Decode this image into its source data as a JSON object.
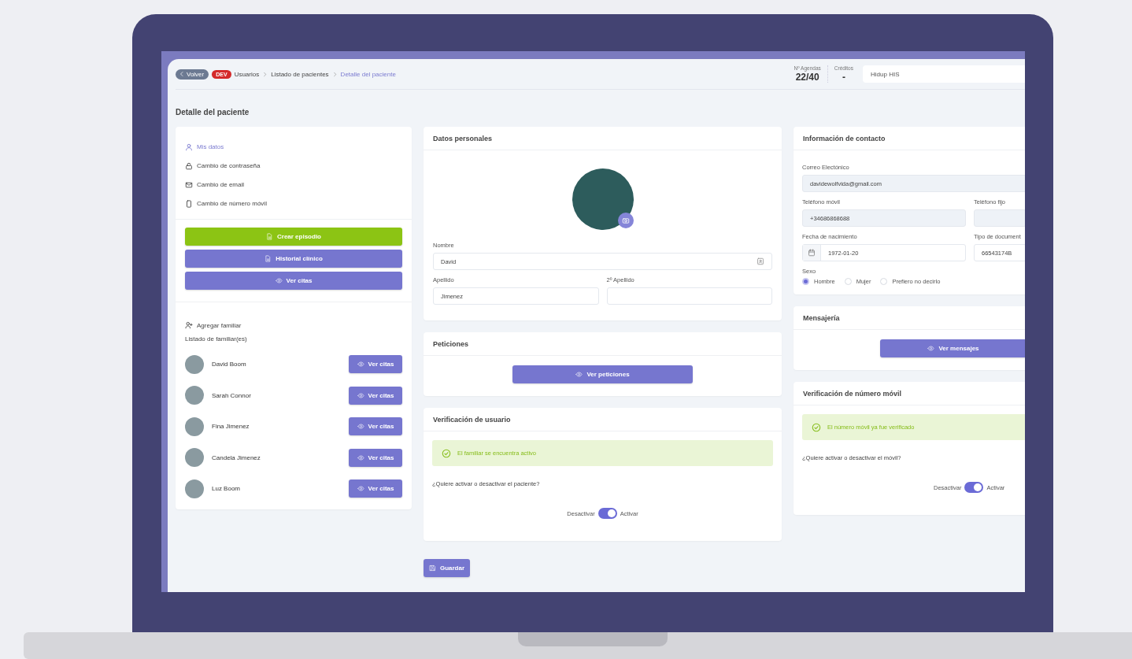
{
  "header": {
    "back_button": "Volver",
    "env_badge": "DEV",
    "breadcrumbs": [
      {
        "label": "Usuarios",
        "current": false
      },
      {
        "label": "Listado de pacientes",
        "current": false
      },
      {
        "label": "Detalle del paciente",
        "current": true
      }
    ],
    "stats": [
      {
        "label": "Nº Agendas",
        "value": "22/40"
      },
      {
        "label": "Créditos",
        "value": "-"
      }
    ],
    "center_select": "Hidup HIS"
  },
  "page_title": "Detalle del paciente",
  "profile_menu": [
    {
      "label": "Mis datos",
      "selected": true
    },
    {
      "label": "Cambio de contraseña",
      "selected": false
    },
    {
      "label": "Cambio de email",
      "selected": false
    },
    {
      "label": "Cambio de número móvil",
      "selected": false
    }
  ],
  "actions": [
    {
      "label": "Crear episodio",
      "kind": "success"
    },
    {
      "label": "Historial clínico",
      "kind": "primary"
    },
    {
      "label": "Ver citas",
      "kind": "primary"
    }
  ],
  "family": {
    "add_label": "Agregar familiar",
    "list_title": "Listado de familiar(es)",
    "members": [
      {
        "name": "David Boom",
        "button": "Ver citas"
      },
      {
        "name": "Sarah Connor",
        "button": "Ver citas"
      },
      {
        "name": "Fina Jimenez",
        "button": "Ver citas"
      },
      {
        "name": "Candela Jimenez",
        "button": "Ver citas"
      },
      {
        "name": "Luz Boom",
        "button": "Ver citas"
      }
    ]
  },
  "personal": {
    "title": "Datos personales",
    "fields": [
      {
        "label": "Nombre",
        "value": "David",
        "kind": "icon"
      },
      {
        "label": "Apellido",
        "value": "Jimenez",
        "kind": "text"
      },
      {
        "label": "2º Apellido",
        "kind": "text"
      }
    ]
  },
  "contact": {
    "title": "Información de contacto",
    "fields": [
      {
        "label": "Correo Electónico",
        "value": "davidewolfvida@gmail.com",
        "kind": "text",
        "disabled": true
      },
      {
        "label": "Teléfono móvil",
        "value": "+34686868688",
        "kind": "text",
        "disabled": true
      },
      {
        "label": "Teléfono fijo",
        "kind": "text",
        "disabled": true
      },
      {
        "label": "Fecha de nacimiento",
        "value": "1972-01-20",
        "kind": "date",
        "disabled": false
      },
      {
        "label": "Tipo de document",
        "value": "66543174B",
        "kind": "text",
        "disabled": false
      }
    ],
    "sex": {
      "label": "Sexo",
      "options": [
        {
          "label": "Hombre",
          "selected": true
        },
        {
          "label": "Mujer",
          "selected": false
        },
        {
          "label": "Prefiero no decirlo",
          "selected": false
        }
      ]
    }
  },
  "requests": {
    "title": "Peticiones",
    "button": "Ver peticiones"
  },
  "messaging": {
    "title": "Mensajería",
    "button": "Ver mensajes"
  },
  "verifications": [
    {
      "title": "Verificación de usuario",
      "alert": "El familiar se encuentra activo",
      "question": "¿Quiere activar o desactivar el paciente?",
      "off_label": "Desactivar",
      "on_label": "Activar",
      "on": true
    },
    {
      "title": "Verificación de número móvil",
      "alert": "El número móvil ya fue verificado",
      "question": "¿Quiere activar o desactivar el móvil?",
      "off_label": "Desactivar",
      "on_label": "Activar",
      "on": true
    }
  ],
  "save_button": "Guardar"
}
